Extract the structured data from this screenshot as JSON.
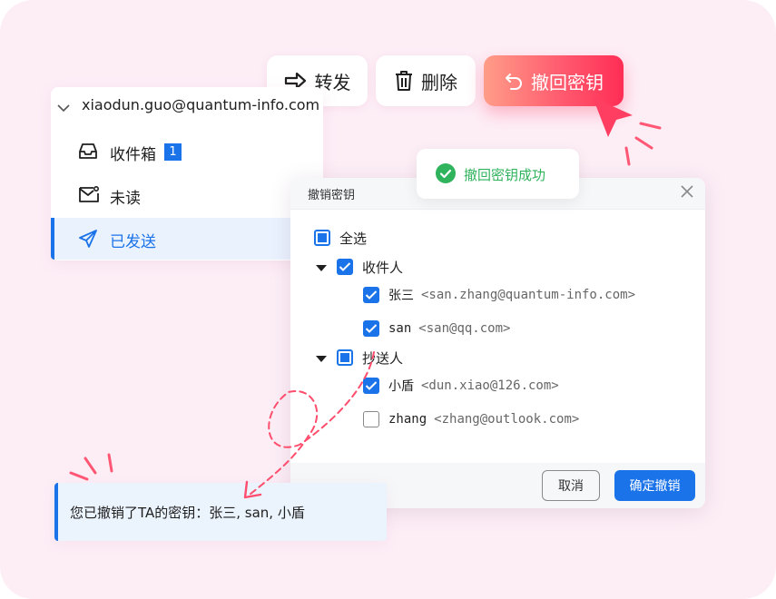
{
  "toolbar": {
    "forward_label": "转发",
    "delete_label": "删除",
    "recall_label": "撤回密钥"
  },
  "sidebar": {
    "account_email": "xiaodun.guo@quantum-info.com",
    "items": [
      {
        "label": "收件箱",
        "badge": "1",
        "icon": "inbox-icon"
      },
      {
        "label": "未读",
        "icon": "mail-icon"
      },
      {
        "label": "已发送",
        "icon": "send-icon",
        "selected": true
      }
    ]
  },
  "toast": {
    "message": "撤回密钥成功",
    "icon": "check-circle-icon"
  },
  "dialog": {
    "title": "撤销密钥",
    "select_all_label": "全选",
    "groups": [
      {
        "label": "收件人",
        "state": "checked",
        "members": [
          {
            "name": "张三",
            "email": "<san.zhang@quantum-info.com>",
            "checked": true
          },
          {
            "name": "san",
            "email": "<san@qq.com>",
            "checked": true
          }
        ]
      },
      {
        "label": "抄送人",
        "state": "partial",
        "members": [
          {
            "name": "小盾",
            "email": "<dun.xiao@126.com>",
            "checked": true
          },
          {
            "name": "zhang",
            "email": "<zhang@outlook.com>",
            "checked": false
          }
        ]
      }
    ],
    "cancel_label": "取消",
    "confirm_label": "确定撤销"
  },
  "notice": {
    "message": "您已撤销了TA的密钥：张三, san, 小盾"
  },
  "colors": {
    "background": "#fdeef6",
    "accent": "#1a73e8",
    "recall_gradient_start": "#ff9d88",
    "recall_gradient_end": "#ff2d55",
    "success": "#2fb35c"
  }
}
